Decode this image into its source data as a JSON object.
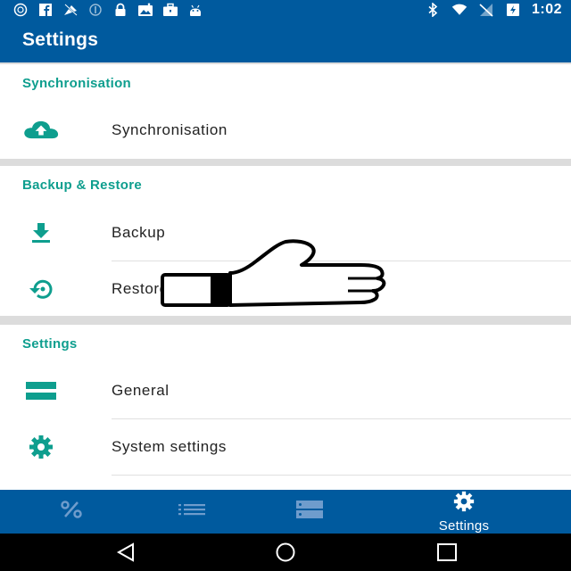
{
  "status_bar": {
    "time": "1:02",
    "left_icons": [
      "sync-icon",
      "facebook-icon",
      "no-signal-icon",
      "circle-status-icon",
      "lock-icon",
      "photo-icon",
      "briefcase-icon",
      "android-icon"
    ],
    "right_icons": [
      "bluetooth-icon",
      "wifi-icon",
      "no-sim-icon",
      "battery-charging-icon"
    ]
  },
  "app_bar": {
    "title": "Settings"
  },
  "sections": [
    {
      "header": "Synchronisation",
      "items": [
        {
          "label": "Synchronisation",
          "icon": "cloud-upload-icon"
        }
      ]
    },
    {
      "header": "Backup & Restore",
      "items": [
        {
          "label": "Backup",
          "icon": "download-icon"
        },
        {
          "label": "Restore",
          "icon": "restore-icon"
        }
      ]
    },
    {
      "header": "Settings",
      "items": [
        {
          "label": "General",
          "icon": "general-icon"
        },
        {
          "label": "System settings",
          "icon": "gear-icon"
        }
      ]
    }
  ],
  "bottom_nav": {
    "items": [
      {
        "label": "",
        "icon": "percent-icon"
      },
      {
        "label": "",
        "icon": "list-icon"
      },
      {
        "label": "",
        "icon": "storage-icon"
      },
      {
        "label": "Settings",
        "icon": "gear-icon",
        "active": true
      }
    ]
  },
  "system_nav": {
    "buttons": [
      "back-icon",
      "home-icon",
      "recents-icon"
    ]
  },
  "overlay": {
    "icon": "thumbs-up-icon"
  },
  "colors": {
    "primary": "#005a9e",
    "accent": "#0e9e8e",
    "inactive_nav_icon": "#6f9ccc"
  }
}
